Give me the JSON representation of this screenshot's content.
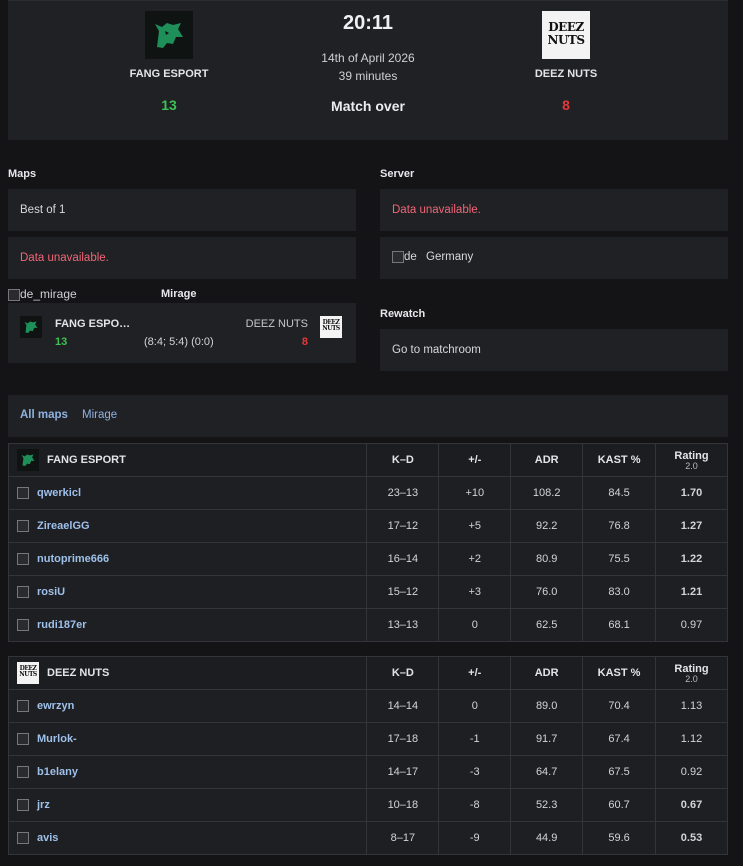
{
  "header": {
    "time": "20:11",
    "date": "14th of April 2026",
    "duration": "39 minutes",
    "status": "Match over",
    "team1": {
      "name": "FANG ESPORT",
      "score": "13"
    },
    "team2": {
      "name": "DEEZ NUTS",
      "score": "8",
      "logo_text": "DEEZ NUTS"
    }
  },
  "maps": {
    "title": "Maps",
    "format": "Best of 1",
    "unavailable": "Data unavailable.",
    "map_image_alt": "de_mirage",
    "map_name": "Mirage",
    "card": {
      "team1_name": "FANG ESPO…",
      "team1_score": "13",
      "halves": "(8:4; 5:4) (0:0)",
      "team2_name": "DEEZ NUTS",
      "team2_score": "8"
    }
  },
  "server": {
    "title": "Server",
    "unavailable": "Data unavailable.",
    "flag_alt": "de",
    "location": "Germany"
  },
  "rewatch": {
    "title": "Rewatch",
    "link": "Go to matchroom"
  },
  "map_tabs": [
    "All maps",
    "Mirage"
  ],
  "columns": {
    "kd": "K–D",
    "plusminus": "+/-",
    "adr": "ADR",
    "kast": "KAST %",
    "rating": "Rating",
    "rating_version": "2.0"
  },
  "teams": [
    {
      "name": "FANG ESPORT",
      "players": [
        {
          "name": "qwerkicl",
          "kd": "23–13",
          "pm": "+10",
          "adr": "108.2",
          "kast": "84.5",
          "rating": "1.70"
        },
        {
          "name": "ZireaelGG",
          "kd": "17–12",
          "pm": "+5",
          "adr": "92.2",
          "kast": "76.8",
          "rating": "1.27"
        },
        {
          "name": "nutoprime666",
          "kd": "16–14",
          "pm": "+2",
          "adr": "80.9",
          "kast": "75.5",
          "rating": "1.22"
        },
        {
          "name": "rosiU",
          "kd": "15–12",
          "pm": "+3",
          "adr": "76.0",
          "kast": "83.0",
          "rating": "1.21"
        },
        {
          "name": "rudi187er",
          "kd": "13–13",
          "pm": "0",
          "adr": "62.5",
          "kast": "68.1",
          "rating": "0.97"
        }
      ]
    },
    {
      "name": "DEEZ NUTS",
      "players": [
        {
          "name": "ewrzyn",
          "kd": "14–14",
          "pm": "0",
          "adr": "89.0",
          "kast": "70.4",
          "rating": "1.13"
        },
        {
          "name": "Murlok-",
          "kd": "17–18",
          "pm": "-1",
          "adr": "91.7",
          "kast": "67.4",
          "rating": "1.12"
        },
        {
          "name": "b1elany",
          "kd": "14–17",
          "pm": "-3",
          "adr": "64.7",
          "kast": "67.5",
          "rating": "0.92"
        },
        {
          "name": "jrz",
          "kd": "10–18",
          "pm": "-8",
          "adr": "52.3",
          "kast": "60.7",
          "rating": "0.67"
        },
        {
          "name": "avis",
          "kd": "8–17",
          "pm": "-9",
          "adr": "44.9",
          "kast": "59.6",
          "rating": "0.53"
        }
      ]
    }
  ]
}
